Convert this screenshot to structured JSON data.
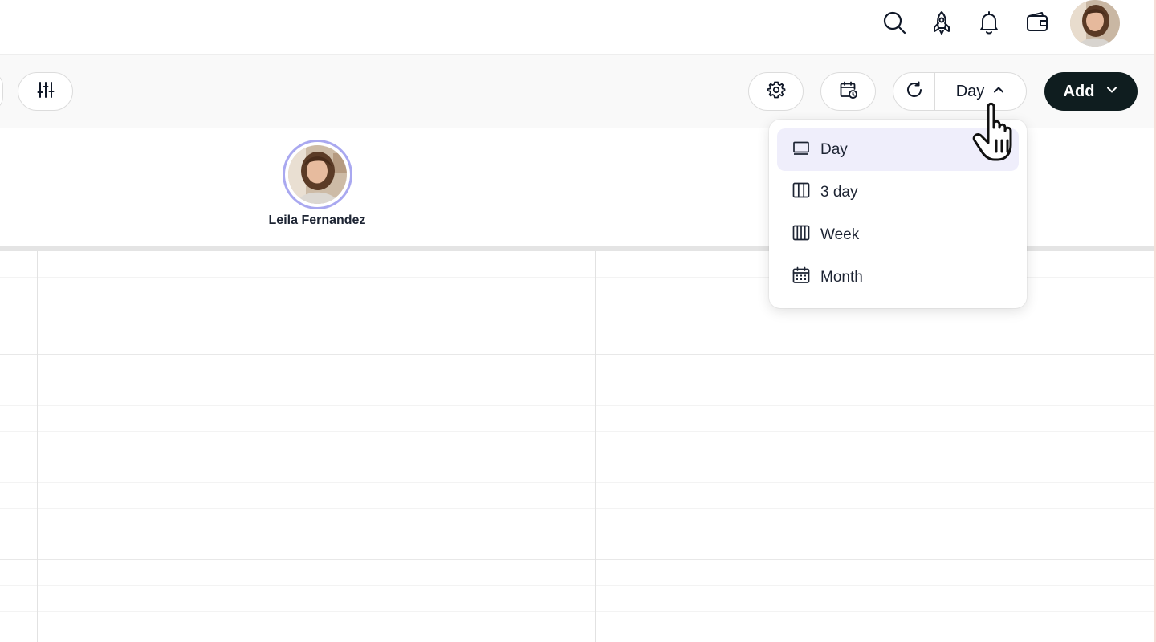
{
  "topbar": {
    "icons": [
      "search-icon",
      "rocket-icon",
      "bell-icon",
      "wallet-icon"
    ],
    "avatar": "user-avatar"
  },
  "toolbar": {
    "filter_icon": "sliders-icon",
    "settings_icon": "gear-icon",
    "schedule_icon": "calendar-clock-icon",
    "refresh_icon": "refresh-icon",
    "view_label": "Day",
    "add_label": "Add"
  },
  "staff": {
    "name": "Leila Fernandez"
  },
  "view_menu": {
    "items": [
      {
        "label": "Day",
        "icon": "day-view-icon",
        "selected": true
      },
      {
        "label": "3 day",
        "icon": "three-day-view-icon",
        "selected": false
      },
      {
        "label": "Week",
        "icon": "week-view-icon",
        "selected": false
      },
      {
        "label": "Month",
        "icon": "month-view-icon",
        "selected": false
      }
    ]
  },
  "colors": {
    "accent": "#a9a8f0",
    "selected_bg": "#efeefb",
    "primary_button": "#0f1d1f"
  }
}
